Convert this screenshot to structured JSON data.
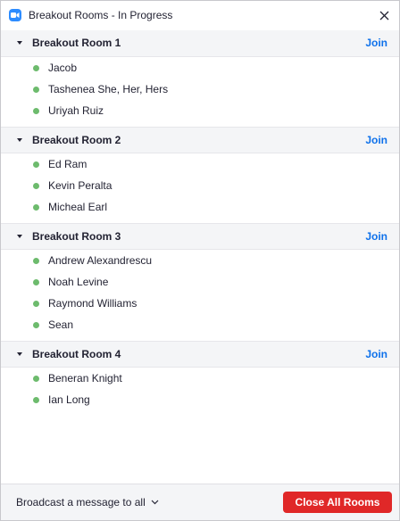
{
  "window": {
    "title": "Breakout Rooms - In Progress",
    "app_icon": "zoom-camera-icon",
    "close_icon": "close-icon"
  },
  "rooms": [
    {
      "name": "Breakout Room 1",
      "join_label": "Join",
      "participants": [
        "Jacob",
        "Tashenea She, Her, Hers",
        "Uriyah Ruiz"
      ]
    },
    {
      "name": "Breakout Room 2",
      "join_label": "Join",
      "participants": [
        "Ed Ram",
        "Kevin Peralta",
        "Micheal Earl"
      ]
    },
    {
      "name": "Breakout Room 3",
      "join_label": "Join",
      "participants": [
        "Andrew Alexandrescu",
        "Noah Levine",
        "Raymond Williams",
        "Sean"
      ]
    },
    {
      "name": "Breakout Room 4",
      "join_label": "Join",
      "participants": [
        "Beneran Knight",
        "Ian Long"
      ]
    }
  ],
  "footer": {
    "broadcast_label": "Broadcast a message to all",
    "close_all_label": "Close All Rooms"
  },
  "colors": {
    "accent": "#0e71eb",
    "danger": "#e02828",
    "status_online": "#6dbb6d",
    "header_bg": "#f4f5f7"
  }
}
